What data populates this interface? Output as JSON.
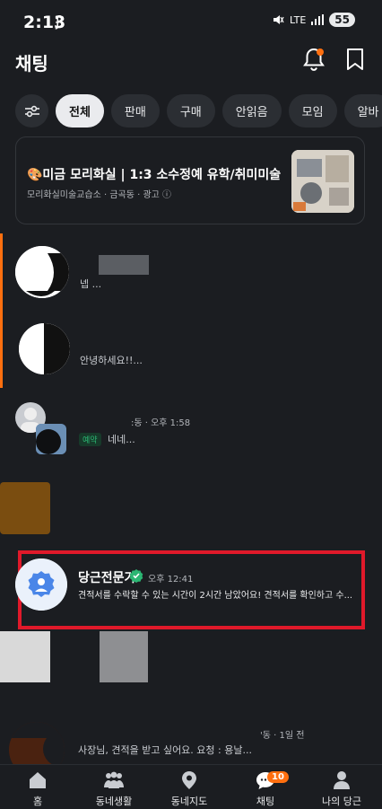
{
  "status_bar": {
    "time": "2:13",
    "app_glyph": "ʄ",
    "network": "LTE",
    "battery": "55"
  },
  "header": {
    "title": "채팅"
  },
  "filters": {
    "settings_icon": "sliders-icon",
    "chips": [
      "전체",
      "판매",
      "구매",
      "안읽음",
      "모임",
      "알바"
    ],
    "active": "전체"
  },
  "ad": {
    "title": "🎨미금 모리화실 | 1:3 소수정예 유학/취미미술",
    "subtitle": "모리화실미술교습소 · 금곡동 · 광고 ⓘ"
  },
  "chats": [
    {
      "message": "넵 ..."
    },
    {
      "message": "안녕하세요!!..."
    },
    {
      "meta": ":동 · 오후 1:58",
      "badge": "예약",
      "message": "네네..."
    },
    {
      "name": "당근전문가",
      "time": "오후 12:41",
      "message": "견적서를 수락할 수 있는 시간이 2시간 남았어요!  견적서를 확인하고 수..."
    },
    {
      "meta": "'동 · 1일 전",
      "message": "사장님, 견적을 받고 싶어요. 요청 : 용날..."
    }
  ],
  "nav": {
    "items": [
      {
        "label": "홈",
        "icon": "home-icon"
      },
      {
        "label": "동네생활",
        "icon": "people-icon"
      },
      {
        "label": "동네지도",
        "icon": "map-pin-icon"
      },
      {
        "label": "채팅",
        "icon": "chat-icon"
      },
      {
        "label": "나의 당근",
        "icon": "person-icon"
      }
    ],
    "chat_badge": "10"
  },
  "colors": {
    "background": "#1b1d21",
    "accent": "#ff6f0f",
    "highlight": "#e0192a",
    "verified": "#2bb673"
  }
}
